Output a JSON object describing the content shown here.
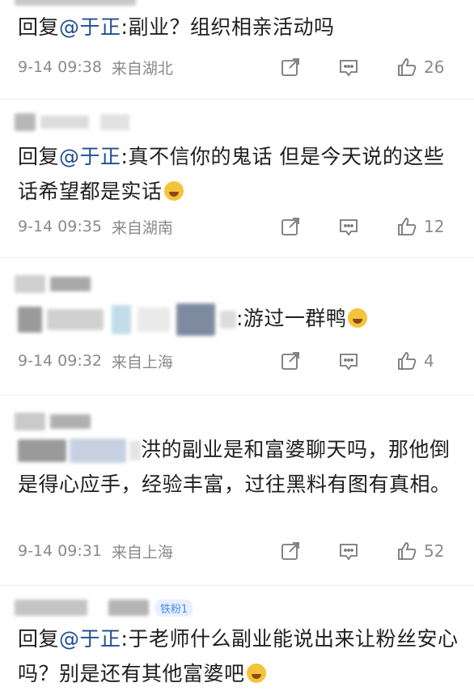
{
  "comments": [
    {
      "reply_prefix": "回复",
      "mention": "@于正",
      "text": ":副业？组织相亲活动吗",
      "time": "9-14 09:38",
      "location": "来自湖北",
      "likes": "26"
    },
    {
      "reply_prefix": "回复",
      "mention": "@于正",
      "text": ":真不信你的鬼话 但是今天说的这些话希望都是实话",
      "time": "9-14 09:35",
      "location": "来自湖南",
      "likes": "12"
    },
    {
      "reply_prefix": "",
      "mention": "",
      "text": ":游过一群鸭",
      "time": "9-14 09:32",
      "location": "来自上海",
      "likes": "4"
    },
    {
      "reply_prefix": "",
      "mention": "",
      "text": "洪的副业是和富婆聊天吗，那他倒是得心应手，经验丰富，过往黑料有图有真相。",
      "time": "9-14 09:31",
      "location": "来自上海",
      "likes": "52"
    },
    {
      "reply_prefix": "回复",
      "mention": "@于正",
      "text": ":于老师什么副业能说出来让粉丝安心吗？别是还有其他富婆吧",
      "badge": "铁粉1"
    }
  ],
  "icons": {
    "share": "share-icon",
    "comment": "comment-icon",
    "like": "thumbs-up-icon",
    "emoji_cry": "crying-emoji-icon",
    "emoji_laugh": "laughing-emoji-icon"
  },
  "colors": {
    "mention": "#1f4e8f",
    "meta": "#8a8a8a"
  }
}
